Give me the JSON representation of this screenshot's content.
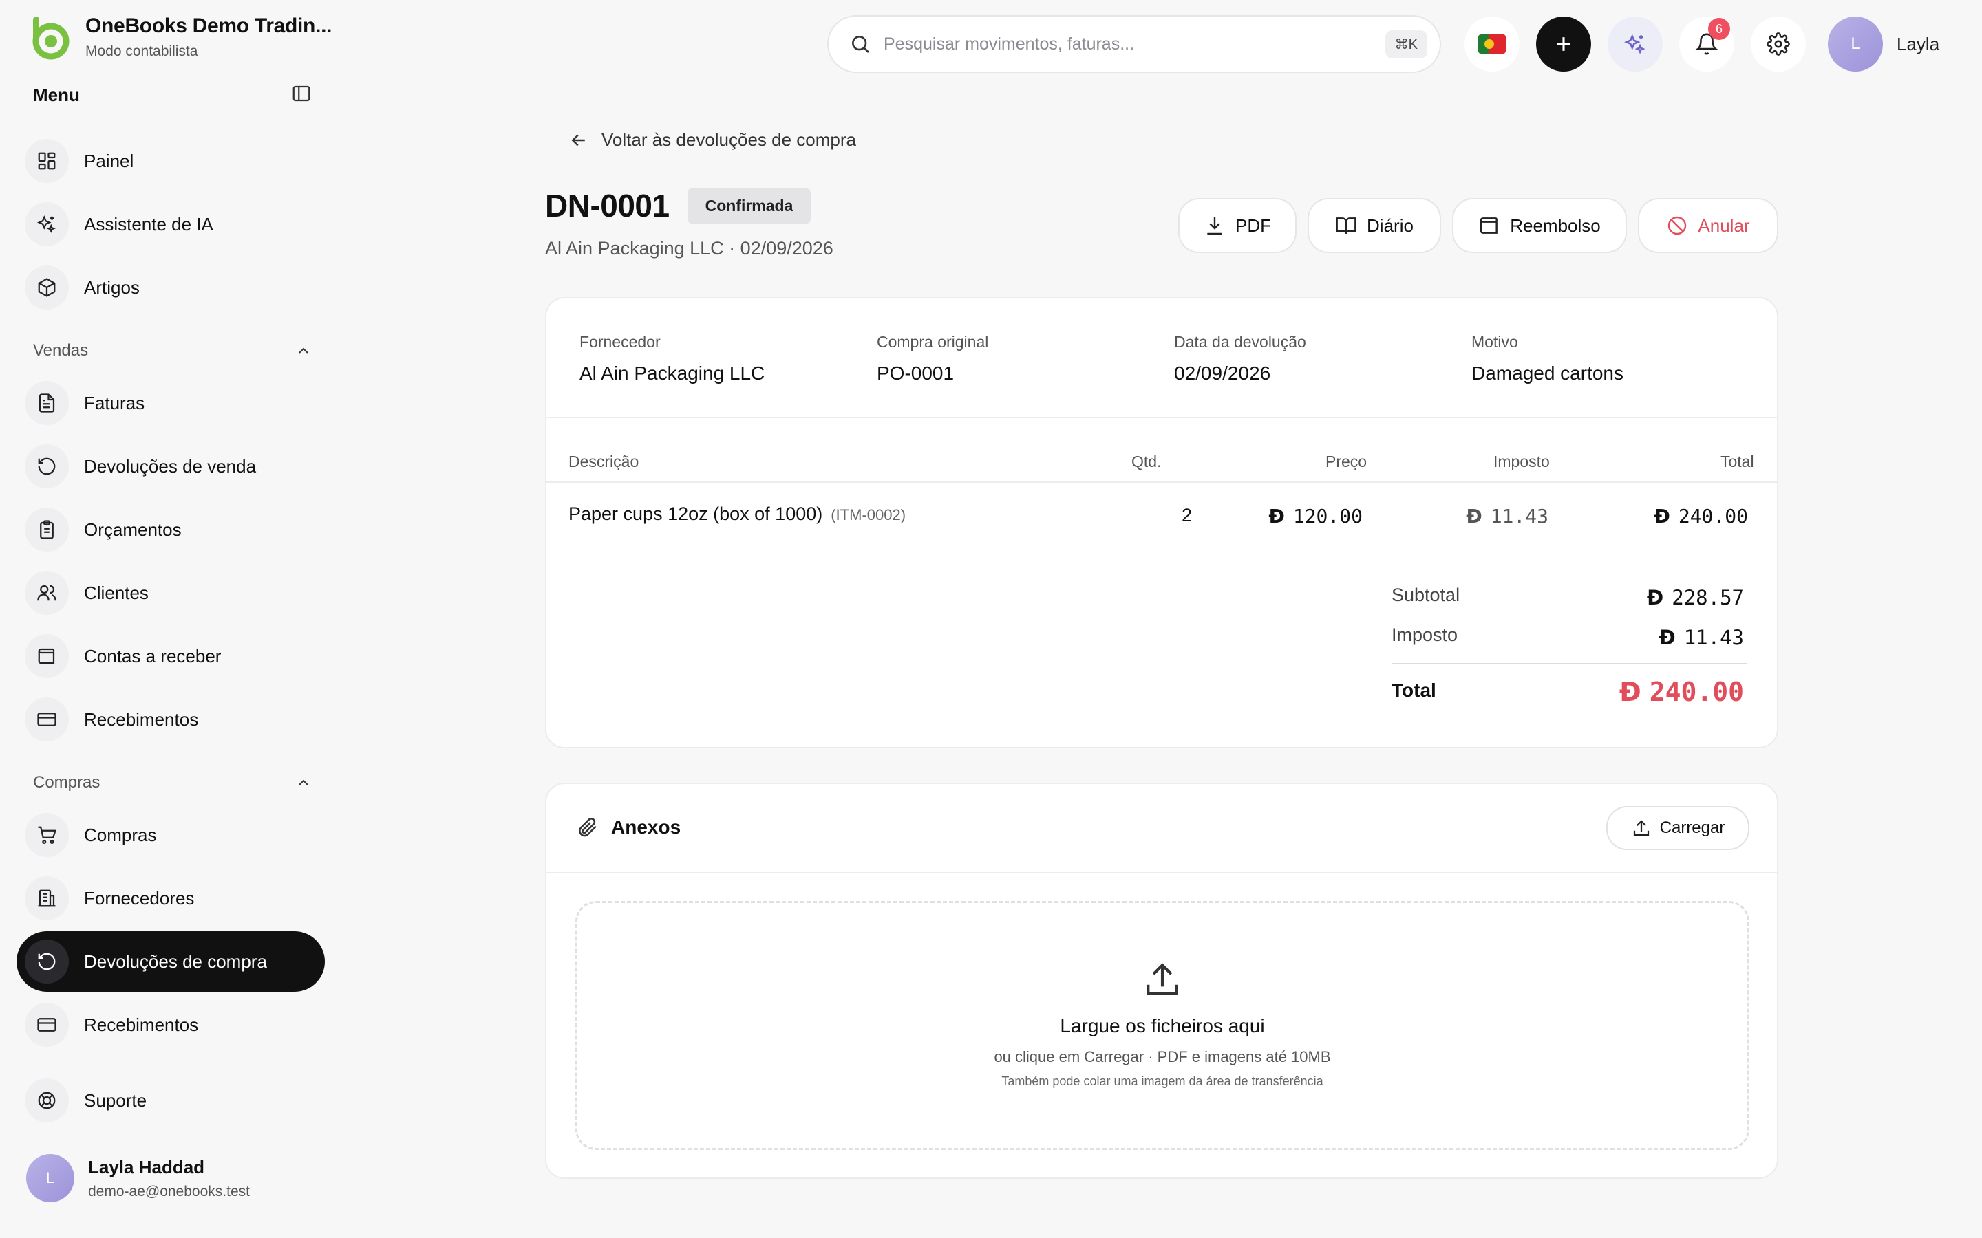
{
  "brand": {
    "name": "OneBooks Demo Tradin...",
    "subtitle": "Modo contabilista"
  },
  "sidebar": {
    "menu_label": "Menu",
    "items": [
      {
        "label": "Painel",
        "icon": "dashboard-icon"
      },
      {
        "label": "Assistente de IA",
        "icon": "sparkles-icon"
      },
      {
        "label": "Artigos",
        "icon": "box-icon"
      }
    ],
    "sales": {
      "label": "Vendas",
      "items": [
        {
          "label": "Faturas",
          "icon": "file-text-icon"
        },
        {
          "label": "Devoluções de venda",
          "icon": "rotate-ccw-icon"
        },
        {
          "label": "Orçamentos",
          "icon": "clipboard-icon"
        },
        {
          "label": "Clientes",
          "icon": "users-icon"
        },
        {
          "label": "Contas a receber",
          "icon": "wallet-icon"
        },
        {
          "label": "Recebimentos",
          "icon": "credit-card-icon"
        }
      ]
    },
    "purchases": {
      "label": "Compras",
      "items": [
        {
          "label": "Compras",
          "icon": "cart-icon"
        },
        {
          "label": "Fornecedores",
          "icon": "building-icon"
        },
        {
          "label": "Devoluções de compra",
          "icon": "rotate-ccw-icon",
          "active": true
        },
        {
          "label": "Recebimentos",
          "icon": "credit-card-icon"
        }
      ]
    },
    "support": {
      "label": "Suporte",
      "icon": "lifebuoy-icon"
    },
    "user": {
      "initial": "L",
      "name": "Layla Haddad",
      "email": "demo-ae@onebooks.test"
    }
  },
  "topbar": {
    "search_placeholder": "Pesquisar movimentos, faturas...",
    "shortcut": "⌘K",
    "notifications_count": "6",
    "user_initial": "L",
    "user_name": "Layla"
  },
  "page": {
    "back_label": "Voltar às devoluções de compra",
    "doc_number": "DN-0001",
    "status": "Confirmada",
    "subtitle": "Al Ain Packaging LLC · 02/09/2026",
    "actions": {
      "pdf": "PDF",
      "journal": "Diário",
      "refund": "Reembolso",
      "void": "Anular"
    }
  },
  "details": {
    "supplier_label": "Fornecedor",
    "supplier": "Al Ain Packaging LLC",
    "original_label": "Compra original",
    "original": "PO-0001",
    "date_label": "Data da devolução",
    "date": "02/09/2026",
    "reason_label": "Motivo",
    "reason": "Damaged cartons"
  },
  "table": {
    "headers": {
      "description": "Descrição",
      "qty": "Qtd.",
      "price": "Preço",
      "tax": "Imposto",
      "total": "Total"
    },
    "rows": [
      {
        "description": "Paper cups 12oz (box of 1000)",
        "code": "(ITM-0002)",
        "qty": "2",
        "price": "120.00",
        "tax": "11.43",
        "total": "240.00"
      }
    ]
  },
  "totals": {
    "currency_symbol": "Ð",
    "subtotal_label": "Subtotal",
    "subtotal": "228.57",
    "tax_label": "Imposto",
    "tax": "11.43",
    "total_label": "Total",
    "total": "240.00"
  },
  "attachments": {
    "title": "Anexos",
    "upload_label": "Carregar",
    "drop_main": "Largue os ficheiros aqui",
    "drop_sub": "ou clique em Carregar · PDF e imagens até 10MB",
    "drop_small": "Também pode colar uma imagem da área de transferência"
  },
  "colors": {
    "accent_green": "#7ac142",
    "danger": "#e14d5a",
    "active_nav": "#111111"
  }
}
